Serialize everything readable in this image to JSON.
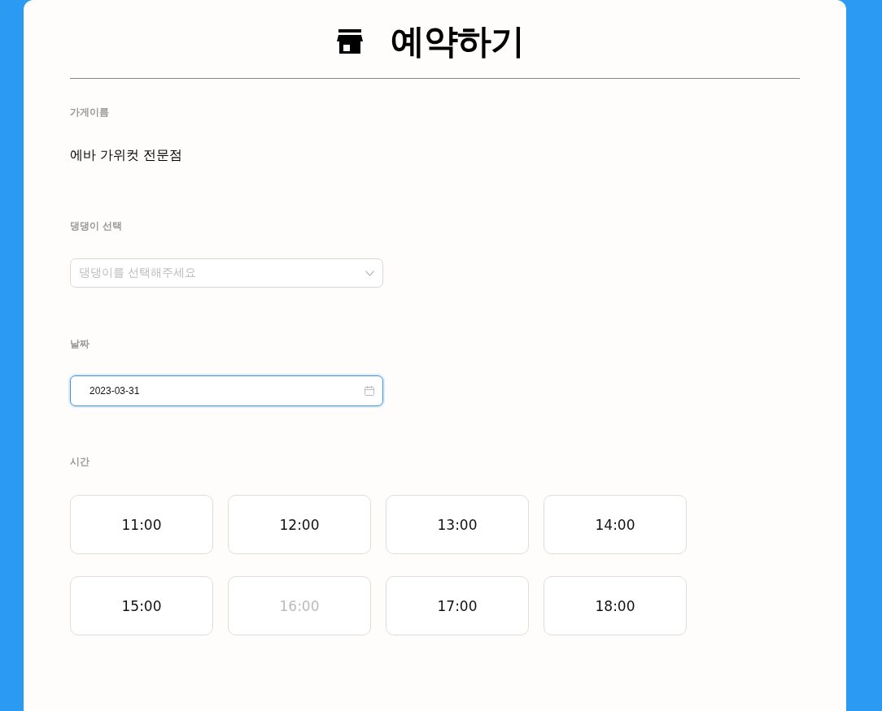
{
  "title": "예약하기",
  "store": {
    "label": "가게이름",
    "value": "에바 가위컷 전문점"
  },
  "dog": {
    "label": "댕댕이 선택",
    "placeholder": "댕댕이를 선택해주세요"
  },
  "date": {
    "label": "날짜",
    "value": "2023-03-31",
    "focused": true
  },
  "time": {
    "label": "시간",
    "slots": [
      {
        "label": "11:00",
        "disabled": false
      },
      {
        "label": "12:00",
        "disabled": false
      },
      {
        "label": "13:00",
        "disabled": false
      },
      {
        "label": "14:00",
        "disabled": false
      },
      {
        "label": "15:00",
        "disabled": false
      },
      {
        "label": "16:00",
        "disabled": true
      },
      {
        "label": "17:00",
        "disabled": false
      },
      {
        "label": "18:00",
        "disabled": false
      }
    ]
  }
}
